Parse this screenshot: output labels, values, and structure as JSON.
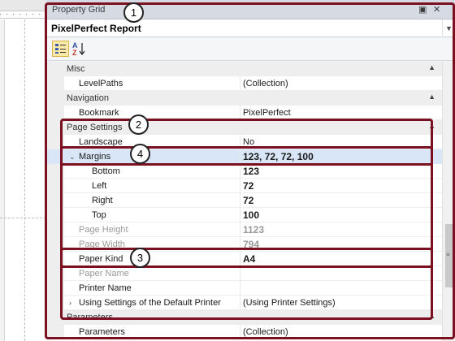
{
  "window": {
    "title": "Property Grid"
  },
  "selector": {
    "value": "PixelPerfect   Report"
  },
  "toolbar": {
    "categorized_icon": "categorized-view-icon",
    "alpha_icon": "alphabetical-sort-icon"
  },
  "rows": [
    {
      "type": "category",
      "name": "Misc"
    },
    {
      "type": "prop",
      "name": "LevelPaths",
      "value": "(Collection)"
    },
    {
      "type": "category",
      "name": "Navigation"
    },
    {
      "type": "prop",
      "name": "Bookmark",
      "value": "PixelPerfect"
    },
    {
      "type": "category",
      "name": "Page Settings"
    },
    {
      "type": "prop",
      "name": "Landscape",
      "value": "No"
    },
    {
      "type": "expanded",
      "name": "Margins",
      "value": "123, 72, 72, 100"
    },
    {
      "type": "sub",
      "name": "Bottom",
      "value": "123"
    },
    {
      "type": "sub",
      "name": "Left",
      "value": "72"
    },
    {
      "type": "sub",
      "name": "Right",
      "value": "72"
    },
    {
      "type": "sub",
      "name": "Top",
      "value": "100"
    },
    {
      "type": "dim",
      "name": "Page Height",
      "value": "1123"
    },
    {
      "type": "dim",
      "name": "Page Width",
      "value": "794"
    },
    {
      "type": "prop",
      "name": "Paper Kind",
      "value": "A4"
    },
    {
      "type": "dim",
      "name": "Paper Name",
      "value": ""
    },
    {
      "type": "prop",
      "name": "Printer Name",
      "value": ""
    },
    {
      "type": "collapsed",
      "name": "Using Settings of the Default Printer",
      "value": "(Using Printer Settings)"
    },
    {
      "type": "category",
      "name": "Parameters"
    },
    {
      "type": "prop",
      "name": "Parameters",
      "value": "(Collection)"
    }
  ],
  "annotations": [
    "1",
    "2",
    "3",
    "4"
  ],
  "icons": {
    "pin": "pin-icon",
    "close": "close-icon",
    "dropdown": "chevron-down-icon"
  }
}
